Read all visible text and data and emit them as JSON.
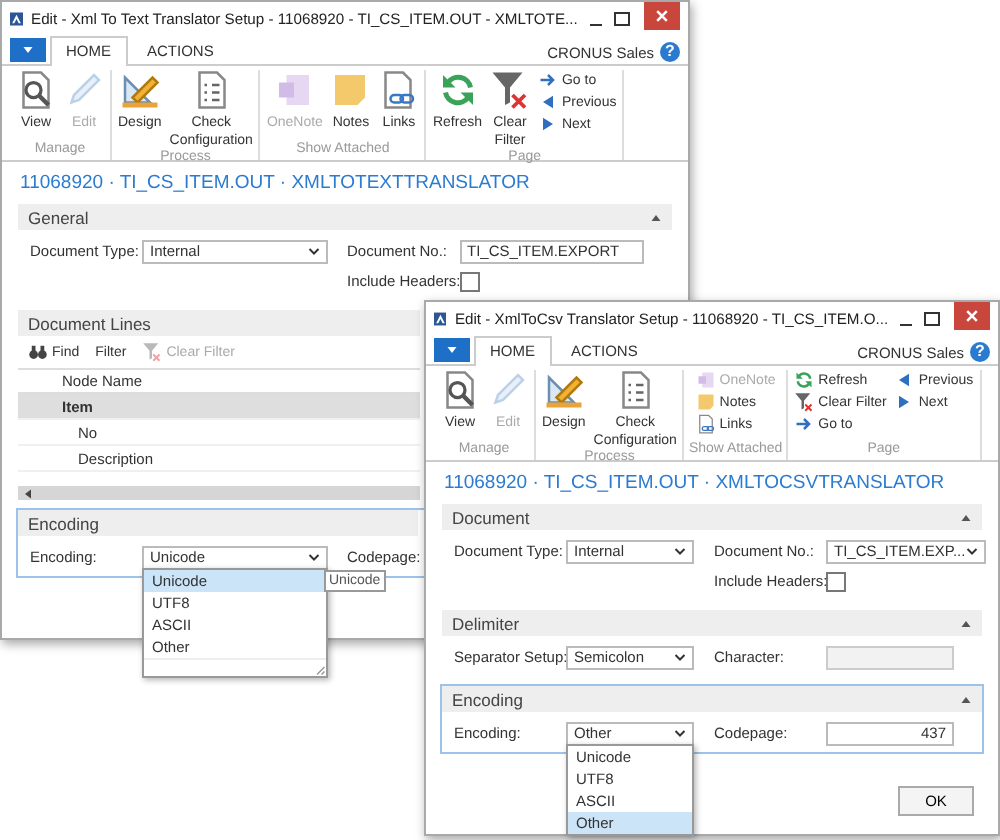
{
  "windows": [
    {
      "title": "Edit - Xml To Text Translator Setup - 11068920 - TI_CS_ITEM.OUT - XMLTOTE...",
      "menu_tabs": [
        {
          "label": "HOME",
          "selected": true
        },
        {
          "label": "ACTIONS",
          "selected": false
        }
      ],
      "company": "CRONUS Sales",
      "help_glyph": "?",
      "groups": [
        {
          "label": "Manage",
          "large_actions": [
            {
              "label": "View",
              "kind": "view",
              "disabled": false
            },
            {
              "label": "Edit",
              "kind": "edit",
              "disabled": true
            }
          ]
        },
        {
          "label": "Process",
          "large_actions": [
            {
              "label": "Design",
              "kind": "design",
              "disabled": false
            },
            {
              "label": "Check Configuration",
              "kind": "check",
              "disabled": false
            }
          ]
        },
        {
          "label": "Show Attached",
          "large_actions": [
            {
              "label": "OneNote",
              "kind": "onenote",
              "disabled": true
            },
            {
              "label": "Notes",
              "kind": "notes",
              "disabled": false
            },
            {
              "label": "Links",
              "kind": "links",
              "disabled": false
            }
          ]
        },
        {
          "label": "Page",
          "large_actions": [
            {
              "label": "Refresh",
              "kind": "refresh",
              "disabled": false
            },
            {
              "label": "Clear Filter",
              "kind": "clearfilter",
              "disabled": false
            }
          ],
          "small_actions": [
            {
              "label": "Go to",
              "kind": "goto",
              "disabled": false
            },
            {
              "label": "Previous",
              "kind": "previous",
              "disabled": false
            },
            {
              "label": "Next",
              "kind": "next",
              "disabled": false
            }
          ]
        }
      ],
      "page_title": "11068920 · TI_CS_ITEM.OUT · XMLTOTEXTTRANSLATOR",
      "sections": [
        {
          "title": "General",
          "kind": "fields",
          "focused": false,
          "expanded": true,
          "columns": [
            [
              {
                "kind": "select",
                "label": "Document Type:",
                "value": "Internal"
              }
            ],
            [
              {
                "kind": "text",
                "label": "Document No.:",
                "value": "TI_CS_ITEM.EXPORT"
              },
              {
                "kind": "checkbox",
                "label": "Include Headers:",
                "checked": false
              }
            ]
          ]
        },
        {
          "title": "Document Lines",
          "kind": "lines",
          "focused": false,
          "toolbar": [
            {
              "label": "Find",
              "kind": "find",
              "disabled": false
            },
            {
              "label": "Filter",
              "kind": "filter",
              "disabled": false
            },
            {
              "label": "Clear Filter",
              "kind": "clearfilter",
              "disabled": true
            }
          ],
          "table": {
            "columns": [
              "Node Name"
            ],
            "rows": [
              {
                "name": "Item",
                "selected": true,
                "children": [
                  {
                    "name": "No",
                    "selected": false
                  },
                  {
                    "name": "Description",
                    "selected": false
                  }
                ]
              }
            ]
          }
        },
        {
          "title": "Encoding",
          "kind": "fields",
          "focused": true,
          "columns": [
            [
              {
                "kind": "select",
                "label": "Encoding:",
                "value": "Unicode",
                "resize_grip": true,
                "tooltip": "Unicode",
                "options": [
                  {
                    "label": "Unicode",
                    "selected": true
                  },
                  {
                    "label": "UTF8",
                    "selected": false
                  },
                  {
                    "label": "ASCII",
                    "selected": false
                  },
                  {
                    "label": "Other",
                    "selected": false
                  }
                ]
              }
            ],
            [
              {
                "kind": "label",
                "label": "Codepage:"
              }
            ]
          ]
        }
      ]
    },
    {
      "title": "Edit - XmlToCsv Translator Setup - 11068920 - TI_CS_ITEM.O...",
      "menu_tabs": [
        {
          "label": "HOME",
          "selected": true
        },
        {
          "label": "ACTIONS",
          "selected": false
        }
      ],
      "company": "CRONUS Sales",
      "help_glyph": "?",
      "groups": [
        {
          "label": "Manage",
          "large_actions": [
            {
              "label": "View",
              "kind": "view",
              "disabled": false
            },
            {
              "label": "Edit",
              "kind": "edit",
              "disabled": true
            }
          ]
        },
        {
          "label": "Process",
          "large_actions": [
            {
              "label": "Design",
              "kind": "design",
              "disabled": false
            },
            {
              "label": "Check Configuration",
              "kind": "check",
              "disabled": false
            }
          ]
        },
        {
          "label": "Show Attached",
          "small_actions": [
            {
              "label": "OneNote",
              "kind": "onenote",
              "disabled": true
            },
            {
              "label": "Notes",
              "kind": "notes",
              "disabled": false
            },
            {
              "label": "Links",
              "kind": "links",
              "disabled": false
            }
          ]
        },
        {
          "label": "Page",
          "small_actions": [
            {
              "label": "Refresh",
              "kind": "refresh",
              "disabled": false
            },
            {
              "label": "Clear Filter",
              "kind": "clearfilter",
              "disabled": false
            },
            {
              "label": "Go to",
              "kind": "goto",
              "disabled": false
            },
            {
              "label": "Previous",
              "kind": "previous",
              "disabled": false
            },
            {
              "label": "Next",
              "kind": "next",
              "disabled": false
            }
          ]
        }
      ],
      "page_title": "11068920 · TI_CS_ITEM.OUT · XMLTOCSVTRANSLATOR",
      "sections": [
        {
          "title": "Document",
          "kind": "fields",
          "focused": false,
          "expanded": true,
          "columns": [
            [
              {
                "kind": "select",
                "label": "Document Type:",
                "value": "Internal"
              }
            ],
            [
              {
                "kind": "select",
                "label": "Document No.:",
                "value": "TI_CS_ITEM.EXP..."
              },
              {
                "kind": "checkbox",
                "label": "Include Headers:",
                "checked": false
              }
            ]
          ]
        },
        {
          "title": "Delimiter",
          "kind": "fields",
          "focused": false,
          "expanded": true,
          "columns": [
            [
              {
                "kind": "select",
                "label": "Separator Setup:",
                "value": "Semicolon"
              }
            ],
            [
              {
                "kind": "text",
                "label": "Character:",
                "disabled": true
              }
            ]
          ]
        },
        {
          "title": "Encoding",
          "kind": "fields",
          "focused": true,
          "expanded": true,
          "columns": [
            [
              {
                "kind": "select",
                "label": "Encoding:",
                "value": "Other",
                "options": [
                  {
                    "label": "Unicode",
                    "selected": false
                  },
                  {
                    "label": "UTF8",
                    "selected": false
                  },
                  {
                    "label": "ASCII",
                    "selected": false
                  },
                  {
                    "label": "Other",
                    "selected": true
                  }
                ]
              }
            ],
            [
              {
                "kind": "number",
                "label": "Codepage:",
                "value": "437"
              }
            ]
          ]
        }
      ],
      "buttons": [
        "OK"
      ]
    }
  ]
}
